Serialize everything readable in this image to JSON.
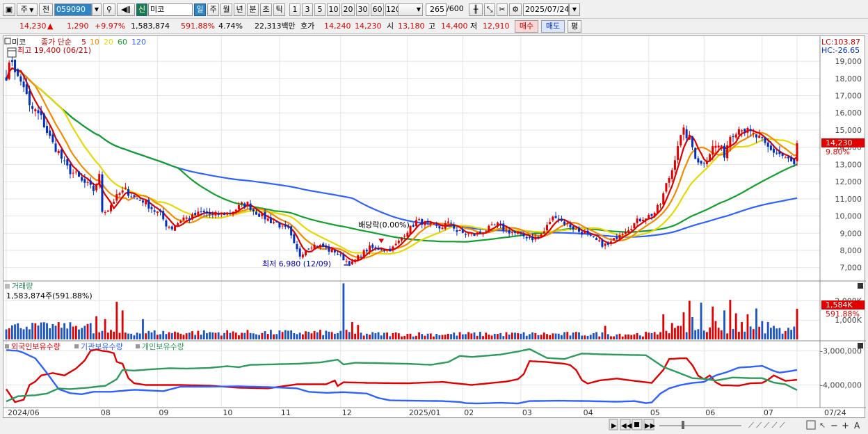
{
  "toolbar": {
    "period_btn": "주",
    "prev_btn": "전",
    "code": "059090",
    "name": "미코",
    "shin": "신",
    "chart_types": [
      "일",
      "주",
      "월",
      "년",
      "분",
      "초",
      "틱"
    ],
    "active_type": "일",
    "minute_opts": [
      "1",
      "3",
      "5",
      "10",
      "20",
      "30",
      "60",
      "120"
    ],
    "count": "265",
    "count_total": "/600",
    "date": "2025/07/24"
  },
  "quote": {
    "price": "14,230",
    "arrow": "▲",
    "change": "1,290",
    "rate": "+9.97%",
    "volume": "1,583,874",
    "vol_ratio": "591.88%",
    "turnover": "4.74%",
    "amount": "22,313백만",
    "bid_label": "호가",
    "bid1": "14,240",
    "bid2": "14,230",
    "open_label": "시",
    "open": "13,180",
    "high_label": "고",
    "high": "14,400",
    "low_label": "저",
    "low": "12,910",
    "buy_btn": "매수",
    "sell_btn": "매도",
    "avg_btn": "평"
  },
  "legend": {
    "name": "미코",
    "label": "종가 단순",
    "periods": [
      "5",
      "10",
      "20",
      "60",
      "120"
    ],
    "period_colors": [
      "#e00000",
      "#f28b00",
      "#e6d800",
      "#129f2d",
      "#2f61ff"
    ],
    "high_note": "최고 19,400 (06/21)",
    "low_note": "최저 6,980 (12/09)",
    "dividend_note": "배당락(0.00%)",
    "lc": "LC:103.87",
    "hc": "HC:-26.65",
    "current_tag": "14,230",
    "current_pct": "9.80%"
  },
  "volume_panel": {
    "title": "거래량",
    "value_note": "1,583,874주(591.88%)",
    "tag": "1,584K",
    "tag_pct": "591.88%"
  },
  "holdings_panel": {
    "labels": [
      "외국인보유수량",
      "기관보유수량",
      "개인보유수량"
    ],
    "colors": [
      "#e00000",
      "#2f61ff",
      "#2e9a5e"
    ]
  },
  "chart_data": {
    "type": "candlestick",
    "price_axis": {
      "range": [
        6300,
        19650
      ],
      "ticks": [
        7000,
        8000,
        9000,
        10000,
        11000,
        12000,
        13000,
        14000,
        15000,
        16000,
        17000,
        18000,
        19000
      ],
      "tick_labels": [
        "7,000",
        "8,000",
        "9,000",
        "10,000",
        "11,000",
        "12,000",
        "13,000",
        "14,000",
        "15,000",
        "16,000",
        "17,000",
        "18,000",
        "19,000"
      ]
    },
    "volume_axis": {
      "range": [
        0,
        2950000
      ],
      "ticks": [
        1000000,
        2000000
      ],
      "tick_labels": [
        "1,000K",
        "2,000K"
      ]
    },
    "holdings_axis": {
      "range": [
        -4600000,
        -2850000
      ],
      "ticks": [
        -3000000,
        -4000000
      ],
      "tick_labels": [
        "-3,000,000",
        "-4,000,000"
      ]
    },
    "x_labels": [
      "2024/06",
      "08",
      "09",
      "10",
      "11",
      "12",
      "2025/01",
      "02",
      "03",
      "04",
      "05",
      "06",
      "07",
      "07/24"
    ],
    "x_label_index": [
      0,
      32,
      52,
      74,
      94,
      115,
      138,
      157,
      177,
      198,
      221,
      240,
      260,
      272
    ],
    "close_anchors": [
      [
        0,
        18200
      ],
      [
        2,
        19100
      ],
      [
        4,
        18000
      ],
      [
        6,
        17600
      ],
      [
        8,
        16300
      ],
      [
        10,
        16100
      ],
      [
        12,
        15700
      ],
      [
        14,
        14900
      ],
      [
        16,
        14200
      ],
      [
        18,
        13700
      ],
      [
        20,
        13000
      ],
      [
        22,
        12600
      ],
      [
        24,
        12400
      ],
      [
        26,
        12000
      ],
      [
        28,
        11800
      ],
      [
        30,
        11500
      ],
      [
        32,
        12300
      ],
      [
        33,
        10300
      ],
      [
        35,
        10400
      ],
      [
        37,
        10900
      ],
      [
        39,
        11300
      ],
      [
        41,
        11500
      ],
      [
        43,
        11200
      ],
      [
        45,
        11000
      ],
      [
        47,
        10900
      ],
      [
        49,
        10600
      ],
      [
        51,
        10300
      ],
      [
        53,
        10100
      ],
      [
        55,
        9500
      ],
      [
        57,
        9300
      ],
      [
        59,
        9600
      ],
      [
        61,
        9900
      ],
      [
        63,
        9850
      ],
      [
        65,
        10050
      ],
      [
        67,
        10200
      ],
      [
        69,
        10150
      ],
      [
        71,
        10050
      ],
      [
        73,
        10100
      ],
      [
        75,
        10150
      ],
      [
        77,
        10200
      ],
      [
        79,
        10400
      ],
      [
        81,
        10650
      ],
      [
        83,
        10700
      ],
      [
        85,
        10300
      ],
      [
        87,
        10100
      ],
      [
        89,
        9900
      ],
      [
        91,
        9700
      ],
      [
        93,
        9600
      ],
      [
        95,
        9300
      ],
      [
        97,
        9200
      ],
      [
        99,
        8300
      ],
      [
        101,
        7700
      ],
      [
        103,
        8100
      ],
      [
        105,
        8300
      ],
      [
        107,
        8300
      ],
      [
        109,
        8200
      ],
      [
        111,
        8000
      ],
      [
        113,
        7950
      ],
      [
        115,
        7650
      ],
      [
        117,
        7400
      ],
      [
        119,
        7250
      ],
      [
        121,
        7600
      ],
      [
        123,
        7900
      ],
      [
        125,
        8150
      ],
      [
        127,
        8100
      ],
      [
        129,
        8100
      ],
      [
        131,
        8000
      ],
      [
        133,
        8150
      ],
      [
        135,
        8500
      ],
      [
        137,
        9000
      ],
      [
        139,
        9300
      ],
      [
        141,
        9700
      ],
      [
        143,
        9650
      ],
      [
        145,
        9500
      ],
      [
        147,
        9400
      ],
      [
        149,
        9300
      ],
      [
        151,
        9500
      ],
      [
        153,
        9600
      ],
      [
        155,
        9100
      ],
      [
        157,
        9000
      ],
      [
        159,
        8950
      ],
      [
        161,
        8900
      ],
      [
        163,
        9050
      ],
      [
        165,
        9200
      ],
      [
        167,
        9350
      ],
      [
        169,
        9500
      ],
      [
        171,
        9250
      ],
      [
        173,
        9100
      ],
      [
        175,
        9000
      ],
      [
        177,
        8850
      ],
      [
        179,
        8800
      ],
      [
        181,
        8700
      ],
      [
        183,
        8750
      ],
      [
        185,
        9100
      ],
      [
        187,
        9700
      ],
      [
        189,
        10050
      ],
      [
        191,
        9700
      ],
      [
        193,
        9500
      ],
      [
        195,
        9300
      ],
      [
        197,
        9100
      ],
      [
        199,
        9000
      ],
      [
        201,
        8750
      ],
      [
        203,
        8550
      ],
      [
        205,
        8350
      ],
      [
        207,
        8300
      ],
      [
        209,
        8600
      ],
      [
        211,
        9000
      ],
      [
        213,
        9200
      ],
      [
        215,
        9400
      ],
      [
        217,
        9700
      ],
      [
        219,
        9900
      ],
      [
        221,
        10000
      ],
      [
        223,
        10200
      ],
      [
        225,
        10700
      ],
      [
        227,
        11800
      ],
      [
        229,
        12700
      ],
      [
        231,
        14200
      ],
      [
        233,
        14900
      ],
      [
        235,
        14500
      ],
      [
        237,
        13500
      ],
      [
        239,
        13000
      ],
      [
        241,
        13400
      ],
      [
        243,
        14000
      ],
      [
        245,
        14100
      ],
      [
        247,
        13600
      ],
      [
        249,
        14700
      ],
      [
        251,
        15000
      ],
      [
        253,
        15200
      ],
      [
        255,
        14900
      ],
      [
        257,
        14700
      ],
      [
        259,
        14500
      ],
      [
        261,
        14100
      ],
      [
        263,
        13800
      ],
      [
        265,
        13700
      ],
      [
        267,
        13500
      ],
      [
        269,
        13250
      ],
      [
        271,
        12950
      ],
      [
        272,
        14230
      ]
    ],
    "volume_spikes": [
      [
        31,
        1200000
      ],
      [
        34,
        1050000
      ],
      [
        38,
        1950000
      ],
      [
        40,
        1500000
      ],
      [
        47,
        1050000
      ],
      [
        116,
        2900000
      ],
      [
        119,
        900000
      ],
      [
        121,
        750000
      ],
      [
        206,
        700000
      ],
      [
        226,
        1300000
      ],
      [
        229,
        850000
      ],
      [
        233,
        1400000
      ],
      [
        235,
        2000000
      ],
      [
        236,
        1150000
      ],
      [
        239,
        1900000
      ],
      [
        243,
        1700000
      ],
      [
        244,
        950000
      ],
      [
        247,
        1500000
      ],
      [
        249,
        2050000
      ],
      [
        251,
        1350000
      ],
      [
        253,
        900000
      ],
      [
        255,
        1300000
      ],
      [
        258,
        1600000
      ],
      [
        260,
        950000
      ],
      [
        262,
        900000
      ],
      [
        264,
        700000
      ],
      [
        272,
        1583874
      ]
    ],
    "holdings": {
      "foreign": [
        [
          0,
          -4120000
        ],
        [
          3,
          -4500000
        ],
        [
          6,
          -4430000
        ],
        [
          8,
          -4000000
        ],
        [
          10,
          -3900000
        ],
        [
          12,
          -3720000
        ],
        [
          16,
          -3650000
        ],
        [
          20,
          -3720000
        ],
        [
          24,
          -3520000
        ],
        [
          27,
          -3280000
        ],
        [
          29,
          -3000000
        ],
        [
          31,
          -2960000
        ],
        [
          33,
          -3000000
        ],
        [
          35,
          -3020000
        ],
        [
          37,
          -3070000
        ],
        [
          38,
          -3320000
        ],
        [
          40,
          -3380000
        ],
        [
          42,
          -3800000
        ],
        [
          44,
          -3950000
        ],
        [
          48,
          -4000000
        ],
        [
          60,
          -4000000
        ],
        [
          70,
          -4020000
        ],
        [
          80,
          -4080000
        ],
        [
          90,
          -4100000
        ],
        [
          94,
          -4050000
        ],
        [
          100,
          -3980000
        ],
        [
          110,
          -3980000
        ],
        [
          113,
          -3870000
        ],
        [
          114,
          -4030000
        ],
        [
          116,
          -3920000
        ],
        [
          125,
          -3940000
        ],
        [
          138,
          -3950000
        ],
        [
          150,
          -3910000
        ],
        [
          160,
          -4000000
        ],
        [
          172,
          -3900000
        ],
        [
          176,
          -3830000
        ],
        [
          178,
          -3680000
        ],
        [
          180,
          -3300000
        ],
        [
          186,
          -3330000
        ],
        [
          192,
          -3380000
        ],
        [
          194,
          -3420000
        ],
        [
          196,
          -3560000
        ],
        [
          198,
          -3860000
        ],
        [
          200,
          -3960000
        ],
        [
          204,
          -3870000
        ],
        [
          210,
          -3810000
        ],
        [
          214,
          -3860000
        ],
        [
          222,
          -3940000
        ],
        [
          226,
          -3560000
        ],
        [
          228,
          -3240000
        ],
        [
          232,
          -3220000
        ],
        [
          234,
          -3220000
        ],
        [
          236,
          -3420000
        ],
        [
          238,
          -3730000
        ],
        [
          240,
          -3830000
        ],
        [
          242,
          -3720000
        ],
        [
          244,
          -3920000
        ],
        [
          246,
          -4010000
        ],
        [
          248,
          -4010000
        ],
        [
          252,
          -4020000
        ],
        [
          256,
          -3950000
        ],
        [
          260,
          -3940000
        ],
        [
          262,
          -3850000
        ],
        [
          264,
          -3720000
        ],
        [
          266,
          -3800000
        ],
        [
          268,
          -3880000
        ],
        [
          272,
          -3850000
        ]
      ],
      "institution": [
        [
          0,
          -2980000
        ],
        [
          4,
          -3000000
        ],
        [
          6,
          -3060000
        ],
        [
          10,
          -3220000
        ],
        [
          14,
          -3650000
        ],
        [
          18,
          -4120000
        ],
        [
          22,
          -4240000
        ],
        [
          26,
          -4270000
        ],
        [
          30,
          -4200000
        ],
        [
          36,
          -4200000
        ],
        [
          44,
          -4140000
        ],
        [
          54,
          -4180000
        ],
        [
          60,
          -4050000
        ],
        [
          70,
          -4050000
        ],
        [
          80,
          -4040000
        ],
        [
          90,
          -4060000
        ],
        [
          100,
          -4100000
        ],
        [
          104,
          -4200000
        ],
        [
          110,
          -4230000
        ],
        [
          116,
          -4210000
        ],
        [
          124,
          -4250000
        ],
        [
          128,
          -4380000
        ],
        [
          132,
          -4450000
        ],
        [
          140,
          -4460000
        ],
        [
          150,
          -4470000
        ],
        [
          156,
          -4500000
        ],
        [
          158,
          -4530000
        ],
        [
          162,
          -4540000
        ],
        [
          170,
          -4520000
        ],
        [
          176,
          -4540000
        ],
        [
          180,
          -4470000
        ],
        [
          190,
          -4460000
        ],
        [
          200,
          -4470000
        ],
        [
          210,
          -4490000
        ],
        [
          216,
          -4470000
        ],
        [
          220,
          -4530000
        ],
        [
          222,
          -4510000
        ],
        [
          225,
          -4250000
        ],
        [
          228,
          -4100000
        ],
        [
          232,
          -4000000
        ],
        [
          236,
          -3940000
        ],
        [
          240,
          -3910000
        ],
        [
          244,
          -3720000
        ],
        [
          248,
          -3620000
        ],
        [
          252,
          -3490000
        ],
        [
          256,
          -3470000
        ],
        [
          260,
          -3440000
        ],
        [
          264,
          -3590000
        ],
        [
          266,
          -3640000
        ],
        [
          270,
          -3590000
        ],
        [
          272,
          -3560000
        ]
      ],
      "individual": [
        [
          0,
          -4480000
        ],
        [
          4,
          -4330000
        ],
        [
          10,
          -4300000
        ],
        [
          14,
          -4250000
        ],
        [
          18,
          -4100000
        ],
        [
          22,
          -4120000
        ],
        [
          28,
          -4080000
        ],
        [
          32,
          -4040000
        ],
        [
          34,
          -4030000
        ],
        [
          38,
          -3830000
        ],
        [
          40,
          -3560000
        ],
        [
          44,
          -3580000
        ],
        [
          50,
          -3540000
        ],
        [
          56,
          -3510000
        ],
        [
          62,
          -3520000
        ],
        [
          70,
          -3500000
        ],
        [
          76,
          -3450000
        ],
        [
          80,
          -3480000
        ],
        [
          84,
          -3410000
        ],
        [
          90,
          -3400000
        ],
        [
          100,
          -3380000
        ],
        [
          108,
          -3340000
        ],
        [
          114,
          -3260000
        ],
        [
          116,
          -3400000
        ],
        [
          120,
          -3350000
        ],
        [
          128,
          -3360000
        ],
        [
          138,
          -3380000
        ],
        [
          146,
          -3410000
        ],
        [
          152,
          -3330000
        ],
        [
          156,
          -3150000
        ],
        [
          160,
          -3180000
        ],
        [
          170,
          -3110000
        ],
        [
          176,
          -3020000
        ],
        [
          180,
          -2950000
        ],
        [
          186,
          -3210000
        ],
        [
          192,
          -3240000
        ],
        [
          198,
          -3080000
        ],
        [
          204,
          -3100000
        ],
        [
          214,
          -3120000
        ],
        [
          220,
          -3130000
        ],
        [
          226,
          -3470000
        ],
        [
          230,
          -3600000
        ],
        [
          236,
          -3800000
        ],
        [
          240,
          -3820000
        ],
        [
          244,
          -3870000
        ],
        [
          250,
          -3780000
        ],
        [
          256,
          -3800000
        ],
        [
          260,
          -3800000
        ],
        [
          264,
          -3930000
        ],
        [
          268,
          -3980000
        ],
        [
          272,
          -4150000
        ]
      ]
    }
  }
}
